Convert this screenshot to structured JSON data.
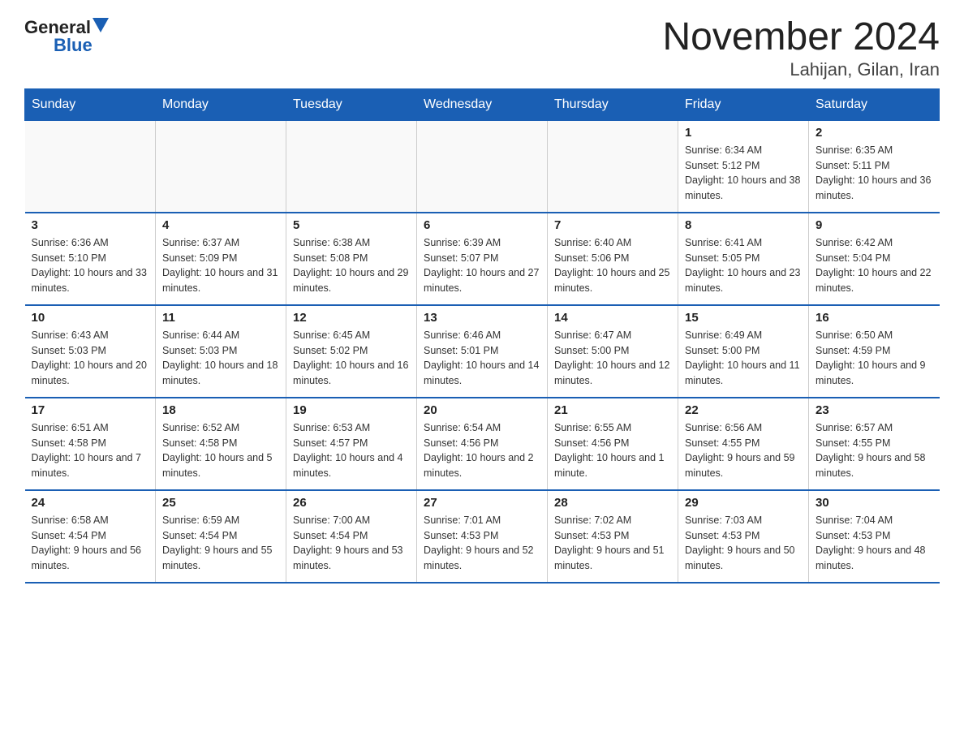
{
  "logo": {
    "general": "General",
    "blue": "Blue"
  },
  "title": "November 2024",
  "subtitle": "Lahijan, Gilan, Iran",
  "weekdays": [
    "Sunday",
    "Monday",
    "Tuesday",
    "Wednesday",
    "Thursday",
    "Friday",
    "Saturday"
  ],
  "weeks": [
    [
      {
        "day": "",
        "info": ""
      },
      {
        "day": "",
        "info": ""
      },
      {
        "day": "",
        "info": ""
      },
      {
        "day": "",
        "info": ""
      },
      {
        "day": "",
        "info": ""
      },
      {
        "day": "1",
        "info": "Sunrise: 6:34 AM\nSunset: 5:12 PM\nDaylight: 10 hours and 38 minutes."
      },
      {
        "day": "2",
        "info": "Sunrise: 6:35 AM\nSunset: 5:11 PM\nDaylight: 10 hours and 36 minutes."
      }
    ],
    [
      {
        "day": "3",
        "info": "Sunrise: 6:36 AM\nSunset: 5:10 PM\nDaylight: 10 hours and 33 minutes."
      },
      {
        "day": "4",
        "info": "Sunrise: 6:37 AM\nSunset: 5:09 PM\nDaylight: 10 hours and 31 minutes."
      },
      {
        "day": "5",
        "info": "Sunrise: 6:38 AM\nSunset: 5:08 PM\nDaylight: 10 hours and 29 minutes."
      },
      {
        "day": "6",
        "info": "Sunrise: 6:39 AM\nSunset: 5:07 PM\nDaylight: 10 hours and 27 minutes."
      },
      {
        "day": "7",
        "info": "Sunrise: 6:40 AM\nSunset: 5:06 PM\nDaylight: 10 hours and 25 minutes."
      },
      {
        "day": "8",
        "info": "Sunrise: 6:41 AM\nSunset: 5:05 PM\nDaylight: 10 hours and 23 minutes."
      },
      {
        "day": "9",
        "info": "Sunrise: 6:42 AM\nSunset: 5:04 PM\nDaylight: 10 hours and 22 minutes."
      }
    ],
    [
      {
        "day": "10",
        "info": "Sunrise: 6:43 AM\nSunset: 5:03 PM\nDaylight: 10 hours and 20 minutes."
      },
      {
        "day": "11",
        "info": "Sunrise: 6:44 AM\nSunset: 5:03 PM\nDaylight: 10 hours and 18 minutes."
      },
      {
        "day": "12",
        "info": "Sunrise: 6:45 AM\nSunset: 5:02 PM\nDaylight: 10 hours and 16 minutes."
      },
      {
        "day": "13",
        "info": "Sunrise: 6:46 AM\nSunset: 5:01 PM\nDaylight: 10 hours and 14 minutes."
      },
      {
        "day": "14",
        "info": "Sunrise: 6:47 AM\nSunset: 5:00 PM\nDaylight: 10 hours and 12 minutes."
      },
      {
        "day": "15",
        "info": "Sunrise: 6:49 AM\nSunset: 5:00 PM\nDaylight: 10 hours and 11 minutes."
      },
      {
        "day": "16",
        "info": "Sunrise: 6:50 AM\nSunset: 4:59 PM\nDaylight: 10 hours and 9 minutes."
      }
    ],
    [
      {
        "day": "17",
        "info": "Sunrise: 6:51 AM\nSunset: 4:58 PM\nDaylight: 10 hours and 7 minutes."
      },
      {
        "day": "18",
        "info": "Sunrise: 6:52 AM\nSunset: 4:58 PM\nDaylight: 10 hours and 5 minutes."
      },
      {
        "day": "19",
        "info": "Sunrise: 6:53 AM\nSunset: 4:57 PM\nDaylight: 10 hours and 4 minutes."
      },
      {
        "day": "20",
        "info": "Sunrise: 6:54 AM\nSunset: 4:56 PM\nDaylight: 10 hours and 2 minutes."
      },
      {
        "day": "21",
        "info": "Sunrise: 6:55 AM\nSunset: 4:56 PM\nDaylight: 10 hours and 1 minute."
      },
      {
        "day": "22",
        "info": "Sunrise: 6:56 AM\nSunset: 4:55 PM\nDaylight: 9 hours and 59 minutes."
      },
      {
        "day": "23",
        "info": "Sunrise: 6:57 AM\nSunset: 4:55 PM\nDaylight: 9 hours and 58 minutes."
      }
    ],
    [
      {
        "day": "24",
        "info": "Sunrise: 6:58 AM\nSunset: 4:54 PM\nDaylight: 9 hours and 56 minutes."
      },
      {
        "day": "25",
        "info": "Sunrise: 6:59 AM\nSunset: 4:54 PM\nDaylight: 9 hours and 55 minutes."
      },
      {
        "day": "26",
        "info": "Sunrise: 7:00 AM\nSunset: 4:54 PM\nDaylight: 9 hours and 53 minutes."
      },
      {
        "day": "27",
        "info": "Sunrise: 7:01 AM\nSunset: 4:53 PM\nDaylight: 9 hours and 52 minutes."
      },
      {
        "day": "28",
        "info": "Sunrise: 7:02 AM\nSunset: 4:53 PM\nDaylight: 9 hours and 51 minutes."
      },
      {
        "day": "29",
        "info": "Sunrise: 7:03 AM\nSunset: 4:53 PM\nDaylight: 9 hours and 50 minutes."
      },
      {
        "day": "30",
        "info": "Sunrise: 7:04 AM\nSunset: 4:53 PM\nDaylight: 9 hours and 48 minutes."
      }
    ]
  ]
}
